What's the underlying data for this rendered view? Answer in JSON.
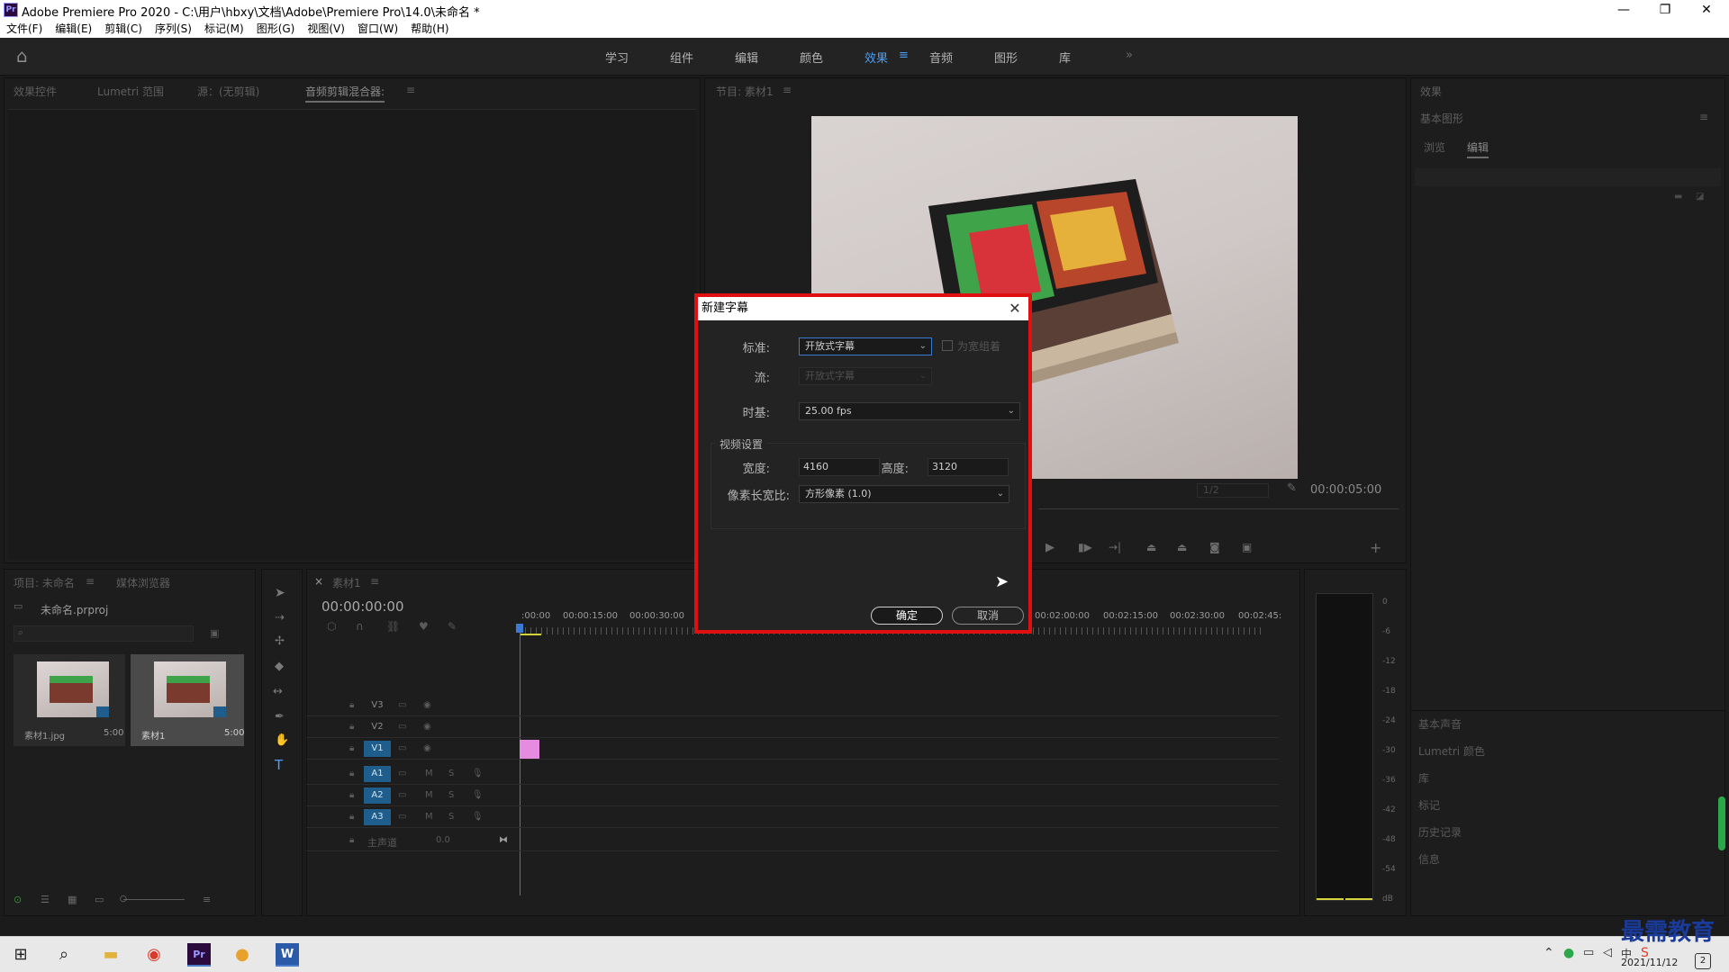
{
  "window": {
    "app_icon": "Pr",
    "title": "Adobe Premiere Pro 2020 - C:\\用户\\hbxy\\文档\\Adobe\\Premiere Pro\\14.0\\未命名 *",
    "minimize": "—",
    "restore": "❐",
    "close": "✕"
  },
  "menu": [
    "文件(F)",
    "编辑(E)",
    "剪辑(C)",
    "序列(S)",
    "标记(M)",
    "图形(G)",
    "视图(V)",
    "窗口(W)",
    "帮助(H)"
  ],
  "workspaces": {
    "home_icon": "⌂",
    "tabs": [
      "学习",
      "组件",
      "编辑",
      "颜色",
      "效果",
      "音频",
      "图形",
      "库"
    ],
    "active": "效果",
    "menu_icon": "≡",
    "more_icon": "»"
  },
  "source_panel": {
    "tabs": [
      "效果控件",
      "Lumetri 范围",
      "源：(无剪辑)",
      "音频剪辑混合器:"
    ],
    "menu_icon": "≡"
  },
  "program_monitor": {
    "title": "节目: 素材1",
    "menu_icon": "≡",
    "resolution": "1/2",
    "duration": "00:00:05:00"
  },
  "project_panel": {
    "tabs": [
      "项目: 未命名",
      "媒体浏览器"
    ],
    "menu_icon": "≡",
    "project_file": "未命名.prproj",
    "items": [
      {
        "name": "素材1.jpg",
        "duration": "5:00"
      },
      {
        "name": "素材1",
        "duration": "5:00"
      }
    ]
  },
  "timeline": {
    "close": "×",
    "sequence": "素材1",
    "menu_icon": "≡",
    "timecode": "00:00:00:00",
    "ruler_left": [
      ":00:00",
      "00:00:15:00",
      "00:00:30:00"
    ],
    "ruler_right": [
      "00:02:00:00",
      "00:02:15:00",
      "00:02:30:00",
      "00:02:45:"
    ],
    "video_tracks": [
      "V3",
      "V2",
      "V1"
    ],
    "audio_tracks": [
      "A1",
      "A2",
      "A3"
    ],
    "mute": "M",
    "solo": "S",
    "master_label": "主声道",
    "master_value": "0.0"
  },
  "audio_meter": {
    "scale": [
      "0",
      "-6",
      "-12",
      "-18",
      "-24",
      "-30",
      "-36",
      "-42",
      "-48",
      "-54",
      "dB"
    ]
  },
  "right_panel": {
    "effects_title": "效果",
    "essential_graphics": "基本图形",
    "menu_icon": "≡",
    "tabs": [
      "浏览",
      "编辑"
    ],
    "active_tab": "编辑",
    "collapsed": [
      "基本声音",
      "Lumetri 颜色",
      "库",
      "标记",
      "历史记录",
      "信息"
    ]
  },
  "dialog": {
    "title": "新建字幕",
    "close": "✕",
    "standard_label": "标准:",
    "standard_value": "开放式字幕",
    "group_checkbox_label": "为宽组着",
    "stream_label": "流:",
    "stream_value": "开放式字幕",
    "timebase_label": "时基:",
    "timebase_value": "25.00 fps",
    "video_settings": "视频设置",
    "width_label": "宽度:",
    "width_value": "4160",
    "height_label": "高度:",
    "height_value": "3120",
    "par_label": "像素长宽比:",
    "par_value": "方形像素 (1.0)",
    "ok": "确定",
    "cancel": "取消",
    "caret": "⌄"
  },
  "taskbar": {
    "date": "2021/11/12",
    "ime": "中",
    "watermark": "最需教育",
    "notification_count": "2"
  },
  "colors": {
    "dialog_highlight": "#e01010",
    "active_workspace": "#4c9df7",
    "track_selected": "#1f5e8c",
    "clip": "#e58ce0",
    "playhead": "#3a7ad6"
  }
}
